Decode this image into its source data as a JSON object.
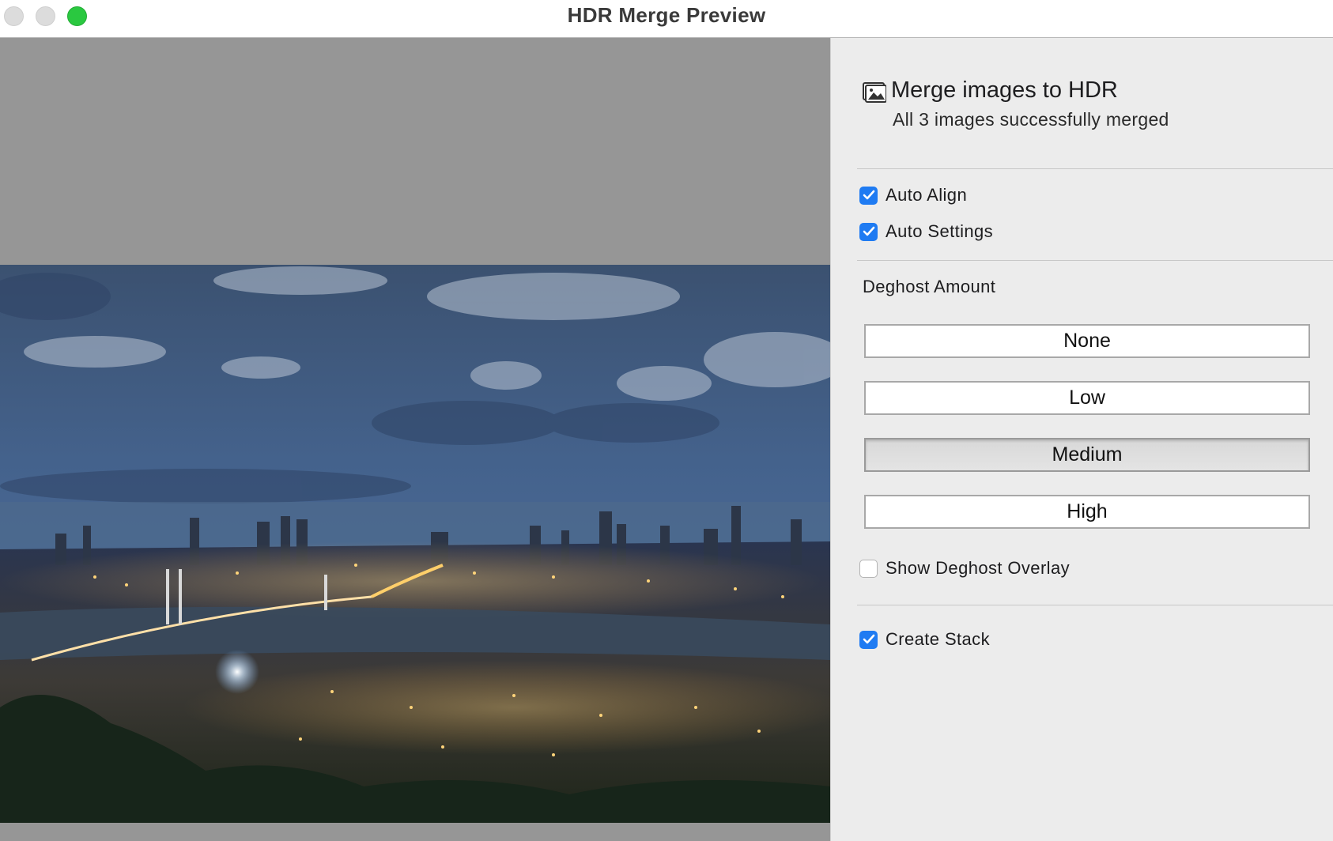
{
  "window": {
    "title": "HDR Merge Preview"
  },
  "header": {
    "icon": "photo-stack-icon",
    "title": "Merge images to HDR",
    "status": "All 3 images successfully merged"
  },
  "options": {
    "auto_align": {
      "label": "Auto Align",
      "checked": true
    },
    "auto_settings": {
      "label": "Auto Settings",
      "checked": true
    },
    "show_overlay": {
      "label": "Show Deghost Overlay",
      "checked": false
    },
    "create_stack": {
      "label": "Create Stack",
      "checked": true
    }
  },
  "deghost": {
    "label": "Deghost Amount",
    "buttons": [
      {
        "label": "None",
        "selected": false
      },
      {
        "label": "Low",
        "selected": false
      },
      {
        "label": "Medium",
        "selected": true
      },
      {
        "label": "High",
        "selected": false
      }
    ]
  },
  "colors": {
    "accent": "#1f7bf2",
    "maximize": "#2ac840",
    "panel_bg": "#ececec",
    "preview_bg": "#969696"
  }
}
